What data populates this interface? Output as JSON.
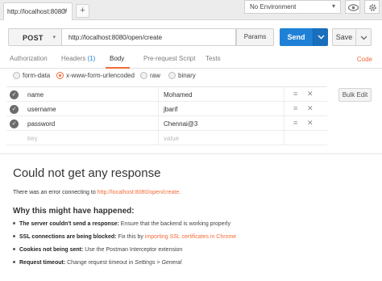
{
  "tabs": [
    {
      "label": "http://localhost:8080/",
      "close": "×"
    }
  ],
  "new_tab": "+",
  "environment": {
    "selected": "No Environment"
  },
  "request": {
    "method": "POST",
    "url": "http://localhost:8080/open/create",
    "params_label": "Params",
    "send_label": "Send",
    "save_label": "Save"
  },
  "subtabs": {
    "authorization": "Authorization",
    "headers": "Headers",
    "headers_count": "(1)",
    "body": "Body",
    "prerequest": "Pre-request Script",
    "tests": "Tests",
    "code": "Code"
  },
  "body_types": [
    {
      "label": "form-data",
      "selected": false
    },
    {
      "label": "x-www-form-urlencoded",
      "selected": true
    },
    {
      "label": "raw",
      "selected": false
    },
    {
      "label": "binary",
      "selected": false
    }
  ],
  "params": [
    {
      "key": "name",
      "value": "Mohamed"
    },
    {
      "key": "username",
      "value": "jbarif"
    },
    {
      "key": "password",
      "value": "Chennai@3"
    }
  ],
  "param_placeholders": {
    "key": "key",
    "value": "value"
  },
  "bulk_edit_label": "Bulk Edit",
  "response": {
    "title": "Could not get any response",
    "message_prefix": "There was an error connecting to ",
    "message_url": "http://localhost:8080/open/create.",
    "why_title": "Why this might have happened:",
    "reasons": {
      "r1_bold": "The server couldn't send a response:",
      "r1_text": " Ensure that the backend is working properly",
      "r2_bold": "SSL connections are being blocked:",
      "r2_text": " Fix this by ",
      "r2_link": "importing SSL certificates in Chrome",
      "r3_bold": "Cookies not being sent:",
      "r3_text": " Use the Postman Interceptor extension",
      "r4_bold": "Request timeout:",
      "r4_text": " Change request timeout in ",
      "r4_italic": "Settings > General"
    }
  },
  "colors": {
    "accent": "#f26b3a",
    "send": "#1f81d6"
  }
}
